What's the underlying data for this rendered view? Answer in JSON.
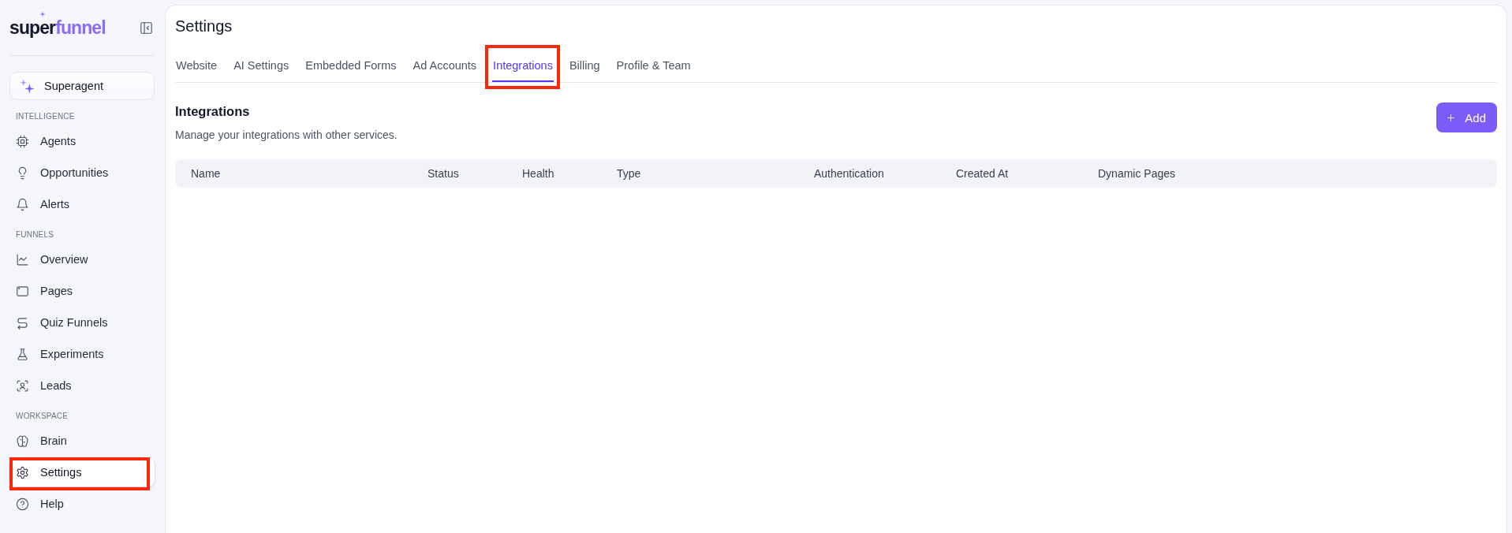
{
  "sidebar": {
    "logo": {
      "dark": "super",
      "accent": "funnel"
    },
    "superagent_button": "Superagent",
    "sections": [
      {
        "title": "INTELLIGENCE",
        "items": [
          {
            "label": "Agents",
            "selected": false,
            "highlighted": false
          },
          {
            "label": "Opportunities",
            "selected": false,
            "highlighted": false
          },
          {
            "label": "Alerts",
            "selected": false,
            "highlighted": false
          }
        ]
      },
      {
        "title": "FUNNELS",
        "items": [
          {
            "label": "Overview",
            "selected": false,
            "highlighted": false
          },
          {
            "label": "Pages",
            "selected": false,
            "highlighted": false
          },
          {
            "label": "Quiz Funnels",
            "selected": false,
            "highlighted": false
          },
          {
            "label": "Experiments",
            "selected": false,
            "highlighted": false
          },
          {
            "label": "Leads",
            "selected": false,
            "highlighted": false
          }
        ]
      },
      {
        "title": "WORKSPACE",
        "items": [
          {
            "label": "Brain",
            "selected": false,
            "highlighted": false
          },
          {
            "label": "Settings",
            "selected": true,
            "highlighted": true
          },
          {
            "label": "Help",
            "selected": false,
            "highlighted": false
          }
        ]
      }
    ]
  },
  "page": {
    "title": "Settings"
  },
  "tabs": [
    {
      "label": "Website",
      "selected": false,
      "highlighted": false
    },
    {
      "label": "AI Settings",
      "selected": false,
      "highlighted": false
    },
    {
      "label": "Embedded Forms",
      "selected": false,
      "highlighted": false
    },
    {
      "label": "Ad Accounts",
      "selected": false,
      "highlighted": false
    },
    {
      "label": "Integrations",
      "selected": true,
      "highlighted": true
    },
    {
      "label": "Billing",
      "selected": false,
      "highlighted": false
    },
    {
      "label": "Profile & Team",
      "selected": false,
      "highlighted": false
    }
  ],
  "integrations": {
    "title": "Integrations",
    "description": "Manage your integrations with other services.",
    "add_button": "Add"
  },
  "table": {
    "columns": [
      "Name",
      "Status",
      "Health",
      "Type",
      "Authentication",
      "Created At",
      "Dynamic Pages"
    ]
  }
}
